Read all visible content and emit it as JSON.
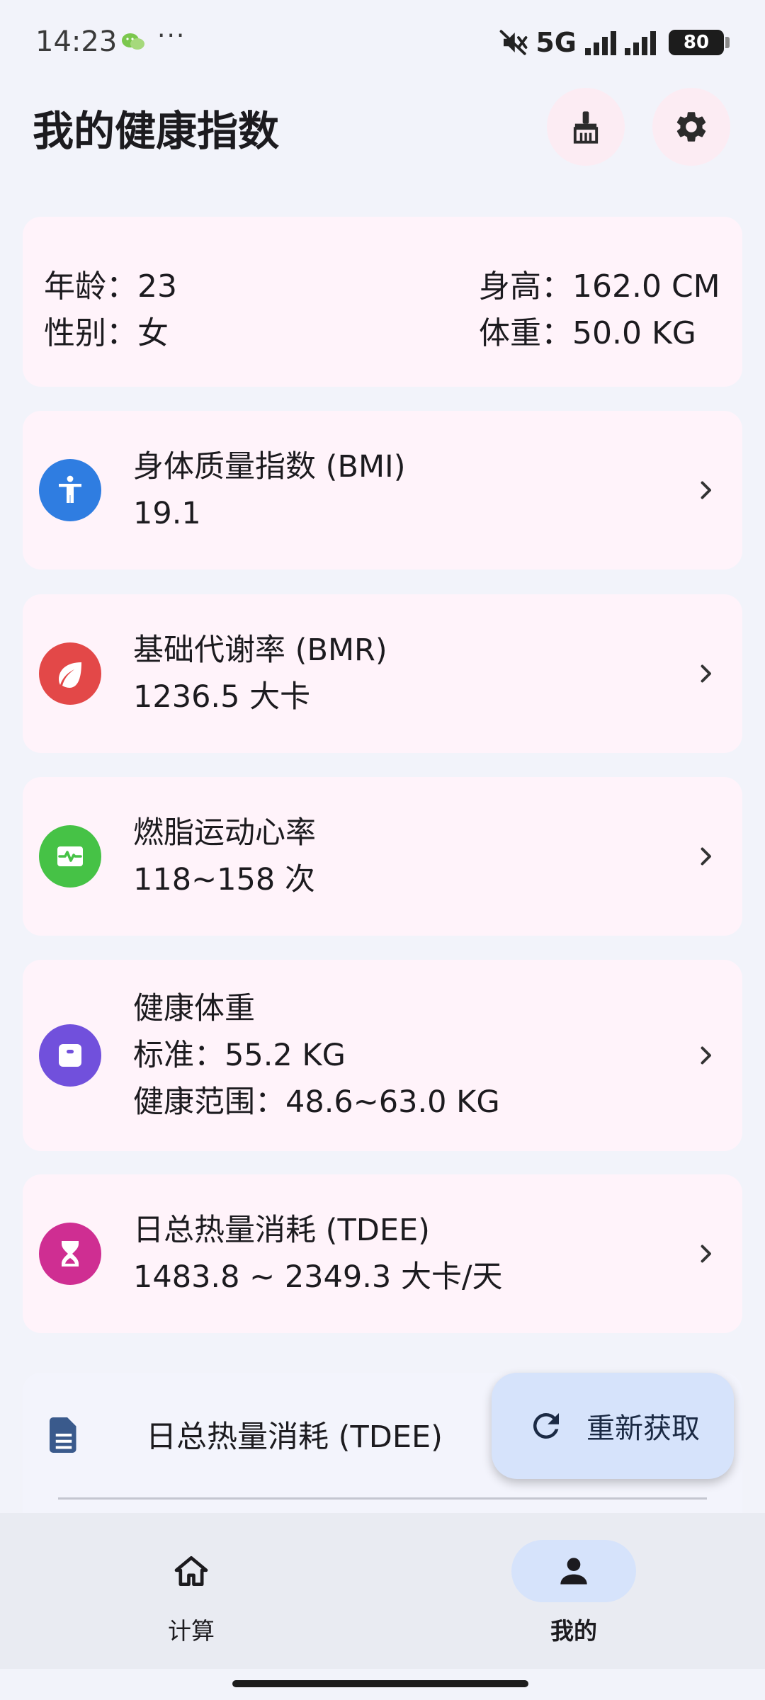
{
  "status_bar": {
    "time": "14:23",
    "dots": "···",
    "network": "5G",
    "battery": "80"
  },
  "header": {
    "title": "我的健康指数"
  },
  "profile": {
    "age": "年龄：23",
    "gender": "性别：女",
    "height": "身高：162.0 CM",
    "weight": "体重：50.0 KG"
  },
  "metrics": {
    "bmi": {
      "title": "身体质量指数 (BMI)",
      "value": "19.1",
      "icon": "accessibility-icon",
      "color": "#2f7de1"
    },
    "bmr": {
      "title": "基础代谢率 (BMR)",
      "value": "1236.5 大卡",
      "icon": "leaf-icon",
      "color": "#e34848"
    },
    "heart_rate": {
      "title": "燃脂运动心率",
      "value": "118~158 次",
      "icon": "heartbeat-monitor-icon",
      "color": "#46c246"
    },
    "healthy_weight": {
      "title": "健康体重",
      "standard": "标准：55.2 KG",
      "range": "健康范围：48.6~63.0 KG",
      "icon": "scale-icon",
      "color": "#7150dc"
    },
    "tdee": {
      "title": "日总热量消耗 (TDEE)",
      "value": "1483.8 ~ 2349.3 大卡/天",
      "icon": "hourglass-icon",
      "color": "#cf2e92"
    }
  },
  "partial_card": {
    "title": "日总热量消耗 (TDEE)"
  },
  "fab": {
    "label": "重新获取"
  },
  "bottom_nav": {
    "items": [
      {
        "label": "计算",
        "icon": "home-icon"
      },
      {
        "label": "我的",
        "icon": "person-icon",
        "selected": true
      }
    ]
  }
}
